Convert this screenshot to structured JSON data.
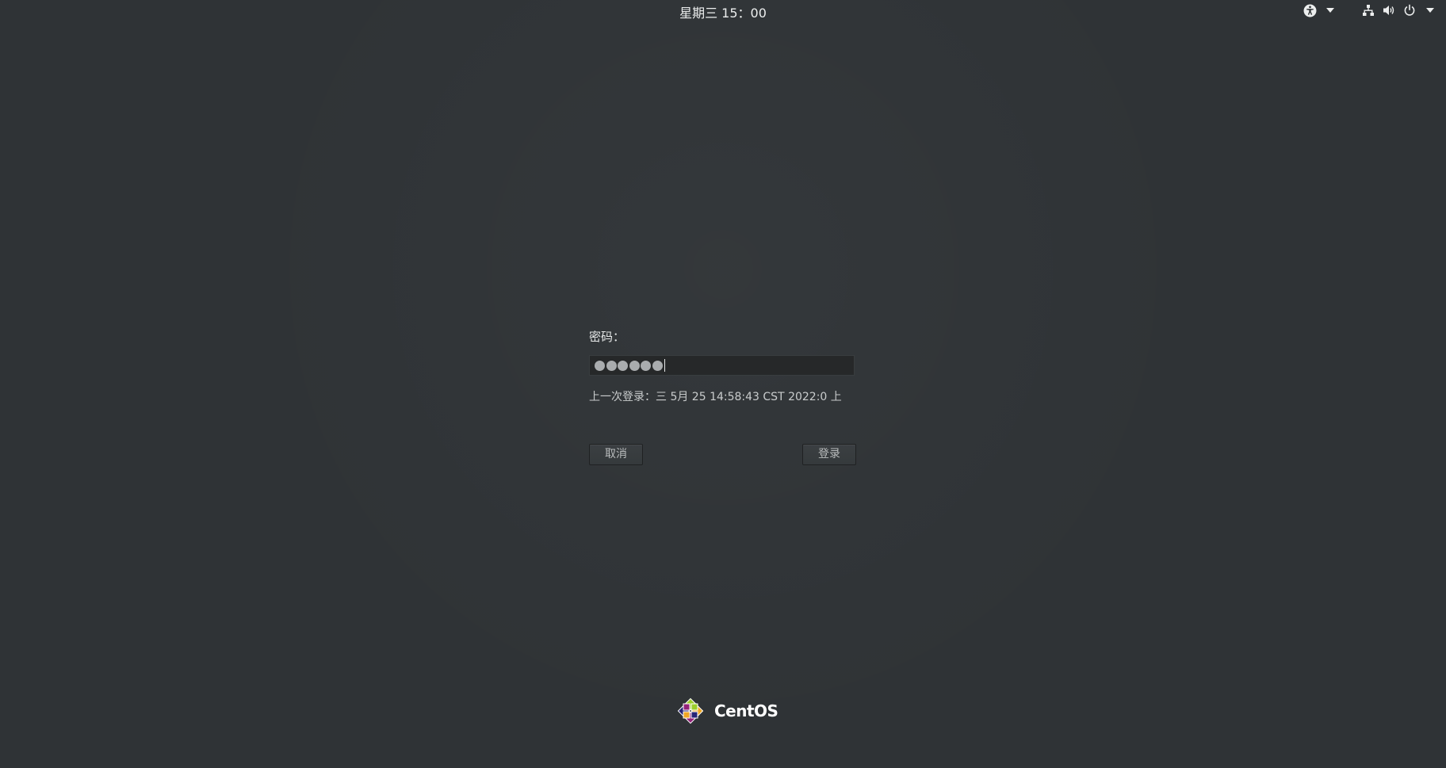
{
  "top_bar": {
    "clock": "星期三 15：00",
    "icons": [
      "accessibility-icon",
      "chevron-down-icon",
      "network-icon",
      "volume-icon",
      "power-icon",
      "chevron-down-icon"
    ]
  },
  "login": {
    "password_label": "密码：",
    "password_dot_count": 6,
    "last_login": "上一次登录：三 5月 25 14:58:43 CST 2022:0 上",
    "cancel_label": "取消",
    "login_label": "登录"
  },
  "branding": {
    "logo_text": "CentOS"
  },
  "colors": {
    "background": "#2f3336",
    "field_background": "#262829",
    "text": "#e6e8e8"
  }
}
